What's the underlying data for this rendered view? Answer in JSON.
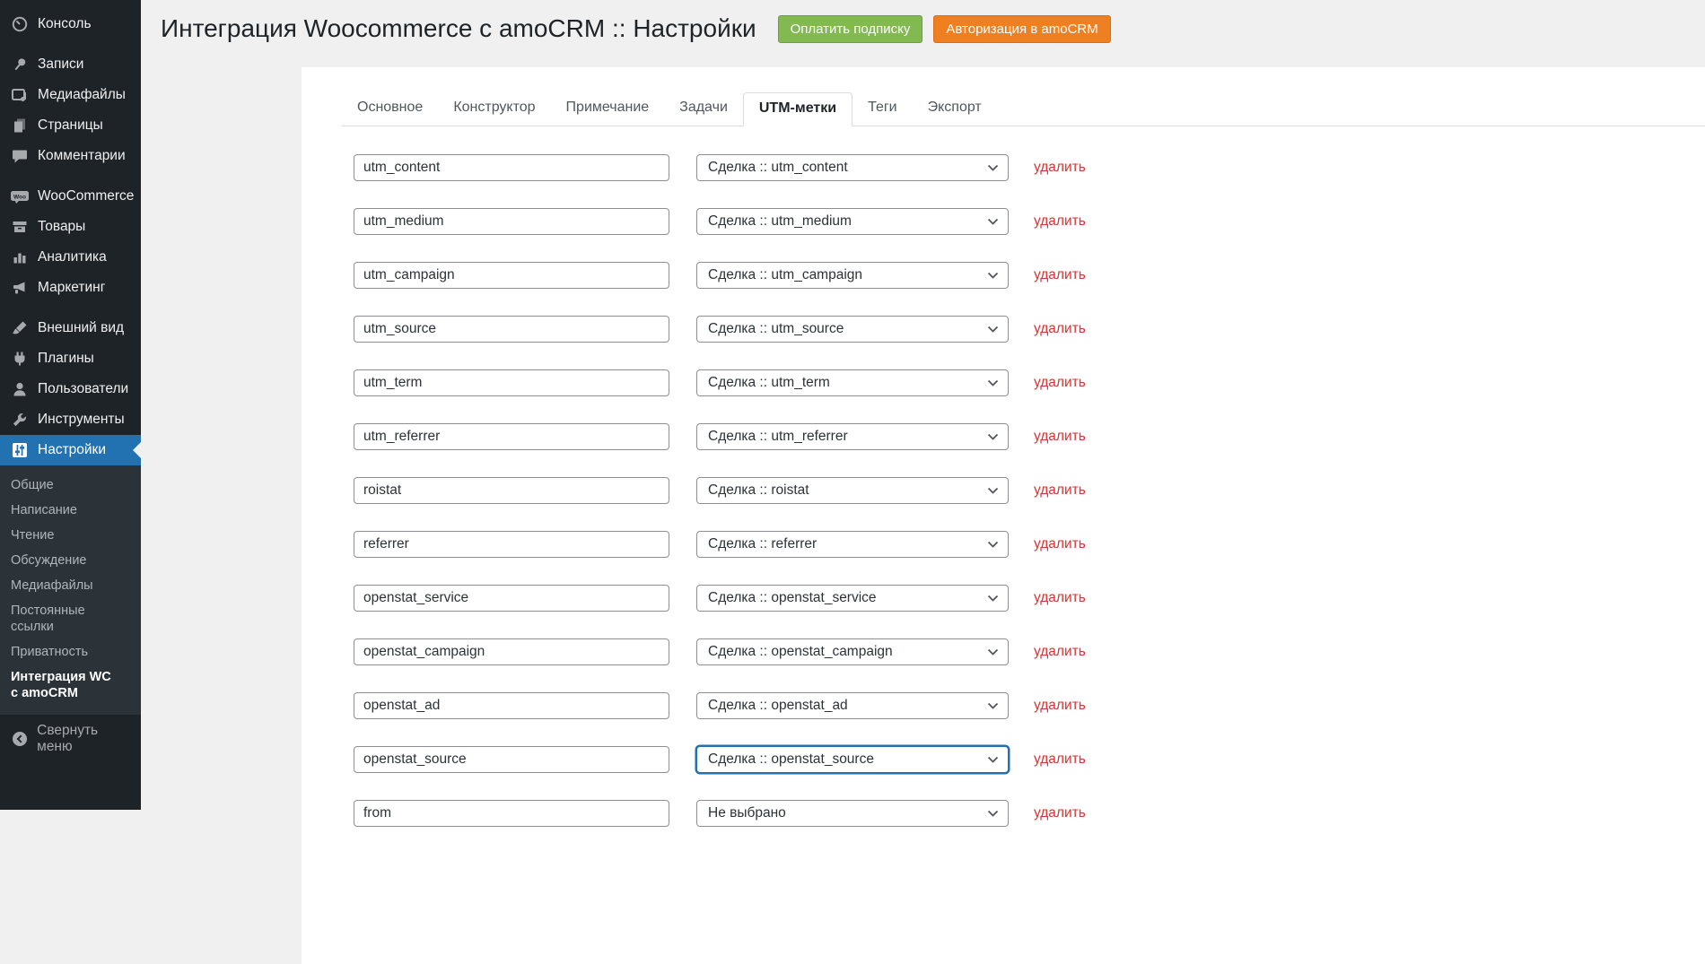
{
  "header": {
    "title": "Интеграция Woocommerce с amoCRM :: Настройки",
    "pay_button_label": "Оплатить подписку",
    "auth_button_label": "Авторизация в amoCRM"
  },
  "sidebar": {
    "menu": [
      {
        "label": "Консоль",
        "icon": "dashboard-icon"
      },
      {
        "label": "Записи",
        "icon": "pushpin-icon"
      },
      {
        "label": "Медиафайлы",
        "icon": "media-icon"
      },
      {
        "label": "Страницы",
        "icon": "pages-icon"
      },
      {
        "label": "Комментарии",
        "icon": "comments-icon"
      },
      {
        "label": "WooCommerce",
        "icon": "woocommerce-icon"
      },
      {
        "label": "Товары",
        "icon": "products-icon"
      },
      {
        "label": "Аналитика",
        "icon": "analytics-icon"
      },
      {
        "label": "Маркетинг",
        "icon": "megaphone-icon"
      },
      {
        "label": "Внешний вид",
        "icon": "appearance-icon"
      },
      {
        "label": "Плагины",
        "icon": "plugin-icon"
      },
      {
        "label": "Пользователи",
        "icon": "users-icon"
      },
      {
        "label": "Инструменты",
        "icon": "tools-icon"
      },
      {
        "label": "Настройки",
        "icon": "settings-icon"
      }
    ],
    "submenu": [
      "Общие",
      "Написание",
      "Чтение",
      "Обсуждение",
      "Медиафайлы",
      "Постоянные ссылки",
      "Приватность",
      "Интеграция WC с amoCRM"
    ],
    "collapse_label": "Свернуть меню"
  },
  "tabs": [
    {
      "label": "Основное"
    },
    {
      "label": "Конструктор"
    },
    {
      "label": "Примечание"
    },
    {
      "label": "Задачи"
    },
    {
      "label": "UTM-метки"
    },
    {
      "label": "Теги"
    },
    {
      "label": "Экспорт"
    }
  ],
  "rows": [
    {
      "field": "utm_content",
      "mapping": "Сделка :: utm_content",
      "delete_label": "удалить"
    },
    {
      "field": "utm_medium",
      "mapping": "Сделка :: utm_medium",
      "delete_label": "удалить"
    },
    {
      "field": "utm_campaign",
      "mapping": "Сделка :: utm_campaign",
      "delete_label": "удалить"
    },
    {
      "field": "utm_source",
      "mapping": "Сделка :: utm_source",
      "delete_label": "удалить"
    },
    {
      "field": "utm_term",
      "mapping": "Сделка :: utm_term",
      "delete_label": "удалить"
    },
    {
      "field": "utm_referrer",
      "mapping": "Сделка :: utm_referrer",
      "delete_label": "удалить"
    },
    {
      "field": "roistat",
      "mapping": "Сделка :: roistat",
      "delete_label": "удалить"
    },
    {
      "field": "referrer",
      "mapping": "Сделка :: referrer",
      "delete_label": "удалить"
    },
    {
      "field": "openstat_service",
      "mapping": "Сделка :: openstat_service",
      "delete_label": "удалить"
    },
    {
      "field": "openstat_campaign",
      "mapping": "Сделка :: openstat_campaign",
      "delete_label": "удалить"
    },
    {
      "field": "openstat_ad",
      "mapping": "Сделка :: openstat_ad",
      "delete_label": "удалить"
    },
    {
      "field": "openstat_source",
      "mapping": "Сделка :: openstat_source",
      "delete_label": "удалить"
    },
    {
      "field": "from",
      "mapping": "Не выбрано",
      "delete_label": "удалить"
    }
  ],
  "colors": {
    "sidebar_bg": "#1d2327",
    "submenu_bg": "#2c3338",
    "accent_blue": "#2271b1",
    "button_green": "#83b951",
    "button_orange": "#ef8022",
    "delete_red": "#dc3232",
    "page_bg": "#f0f0f1"
  }
}
